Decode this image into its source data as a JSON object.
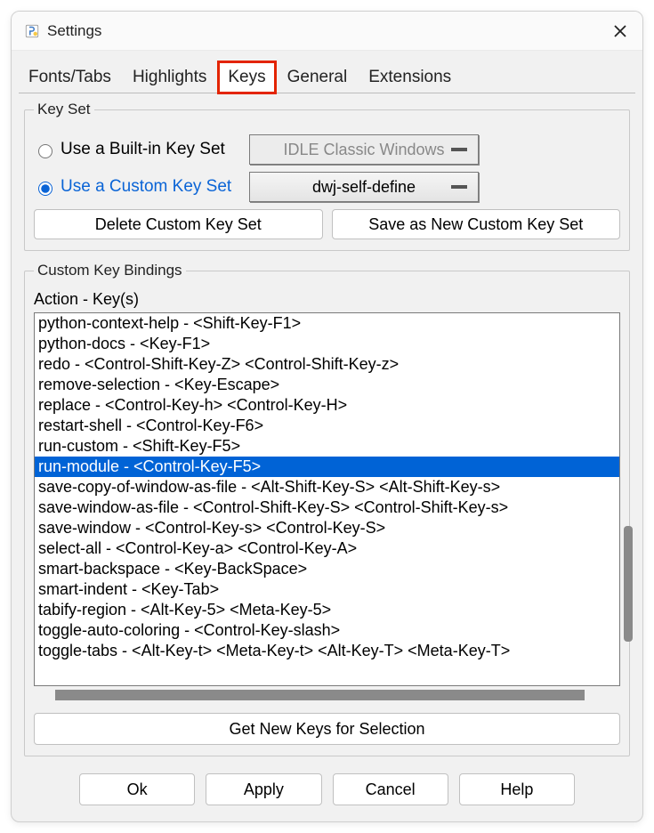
{
  "window": {
    "title": "Settings"
  },
  "tabs": {
    "items": [
      "Fonts/Tabs",
      "Highlights",
      "Keys",
      "General",
      "Extensions"
    ],
    "active_index": 2,
    "highlighted_index": 2
  },
  "keyset": {
    "legend": "Key Set",
    "builtin": {
      "label": "Use a Built-in Key Set",
      "value": "IDLE Classic Windows",
      "selected": false
    },
    "custom": {
      "label": "Use a Custom Key Set",
      "value": "dwj-self-define",
      "selected": true
    },
    "delete_btn": "Delete Custom Key Set",
    "saveas_btn": "Save as New Custom Key Set"
  },
  "bindings": {
    "legend": "Custom Key Bindings",
    "header": "Action - Key(s)",
    "items": [
      "python-context-help - <Shift-Key-F1>",
      "python-docs - <Key-F1>",
      "redo - <Control-Shift-Key-Z> <Control-Shift-Key-z>",
      "remove-selection - <Key-Escape>",
      "replace - <Control-Key-h> <Control-Key-H>",
      "restart-shell - <Control-Key-F6>",
      "run-custom - <Shift-Key-F5>",
      "run-module - <Control-Key-F5>",
      "save-copy-of-window-as-file - <Alt-Shift-Key-S> <Alt-Shift-Key-s>",
      "save-window-as-file - <Control-Shift-Key-S> <Control-Shift-Key-s>",
      "save-window - <Control-Key-s> <Control-Key-S>",
      "select-all - <Control-Key-a> <Control-Key-A>",
      "smart-backspace - <Key-BackSpace>",
      "smart-indent - <Key-Tab>",
      "tabify-region - <Alt-Key-5> <Meta-Key-5>",
      "toggle-auto-coloring - <Control-Key-slash>",
      "toggle-tabs - <Alt-Key-t> <Meta-Key-t> <Alt-Key-T> <Meta-Key-T>"
    ],
    "selected_index": 7,
    "get_new_btn": "Get New Keys for Selection"
  },
  "buttons": {
    "ok": "Ok",
    "apply": "Apply",
    "cancel": "Cancel",
    "help": "Help"
  }
}
